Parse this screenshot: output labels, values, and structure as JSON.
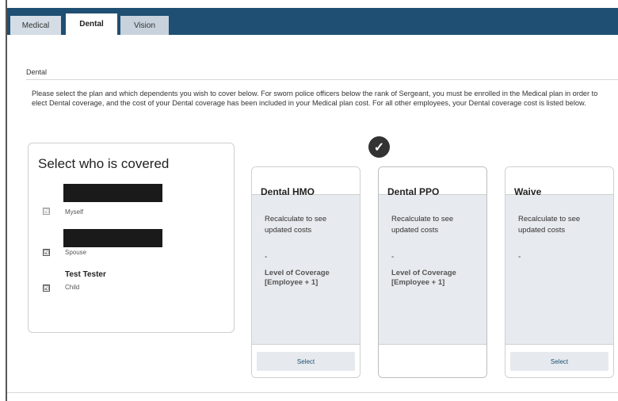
{
  "tabs": {
    "medical": "Medical",
    "dental": "Dental",
    "vision": "Vision"
  },
  "section_title": "Dental",
  "description": "Please select the plan and which dependents you wish to cover below. For sworn police officers below the rank of Sergeant, you must be enrolled in the Medical plan in order to elect Dental coverage, and the cost of your Dental coverage has been included in your Medical plan cost. For all other employees, your Dental coverage cost is listed below.",
  "covered": {
    "title": "Select who is covered",
    "dependents": [
      {
        "name": "",
        "relation": "Myself",
        "checked": true
      },
      {
        "name": "",
        "relation": "Spouse",
        "checked": true
      },
      {
        "name": "Test Tester",
        "relation": "Child",
        "checked": true
      }
    ]
  },
  "plans": [
    {
      "name": "Dental HMO",
      "recalc": "Recalculate to see updated costs",
      "dash": "-",
      "level": "Level of Coverage [Employee + 1]",
      "button": "Select",
      "selected": false
    },
    {
      "name": "Dental PPO",
      "recalc": "Recalculate to see updated costs",
      "dash": "-",
      "level": "Level of Coverage [Employee + 1]",
      "button": "",
      "selected": true
    },
    {
      "name": "Waive",
      "recalc": "Recalculate to see updated costs",
      "dash": "-",
      "level": "",
      "button": "Select",
      "selected": false
    }
  ],
  "icons": {
    "selected_badge": "✓",
    "checkbox": "☑"
  },
  "colors": {
    "header": "#1f4f72",
    "card_body": "#e7eaee"
  }
}
